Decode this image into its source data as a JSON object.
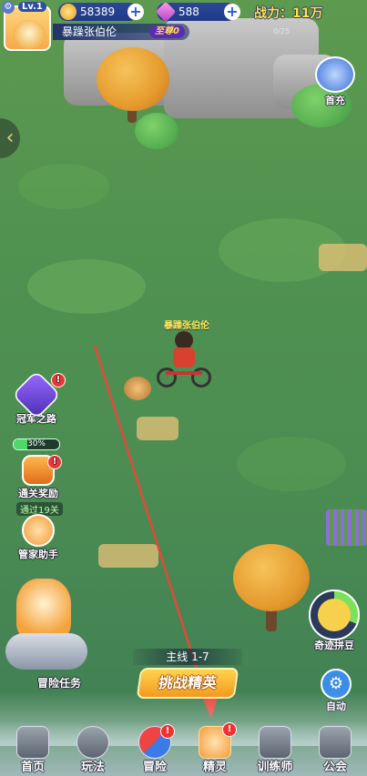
{
  "hud": {
    "level": "Lv.1",
    "gold": "58389",
    "gems": "588",
    "power": "战力：11万",
    "player_name": "暴躁张伯伦",
    "vip": "至尊0",
    "tiny_info": "0/25"
  },
  "side_left": {
    "champion_road": "冠军之路",
    "champion_progress_text": "30%",
    "champion_progress": 0.3,
    "clear_reward": "通关奖励",
    "clear_tag": "通过19关",
    "butler": "管家助手",
    "adventure_task": "冒险任务"
  },
  "side_right": {
    "first_recharge": "首充",
    "puzzle": "奇迹拼豆",
    "puzzle_percent": "31%",
    "auto": "自动"
  },
  "scene": {
    "character_name": "暴躁张伯伦"
  },
  "mission": {
    "stage": "主线 1-7",
    "challenge": "挑战精英"
  },
  "nav": {
    "items": [
      "首页",
      "玩法",
      "冒险",
      "精灵",
      "训练师",
      "公会"
    ]
  },
  "colors": {
    "grass": "#4f9150",
    "accent_gold": "#f39a1d",
    "badge_red": "#e33333",
    "annotation_arrow": "#e5483b"
  },
  "icons": {
    "gold": "coin-icon",
    "gems": "gem-icon",
    "settings": "gear-icon",
    "auto": "gear-icon"
  }
}
